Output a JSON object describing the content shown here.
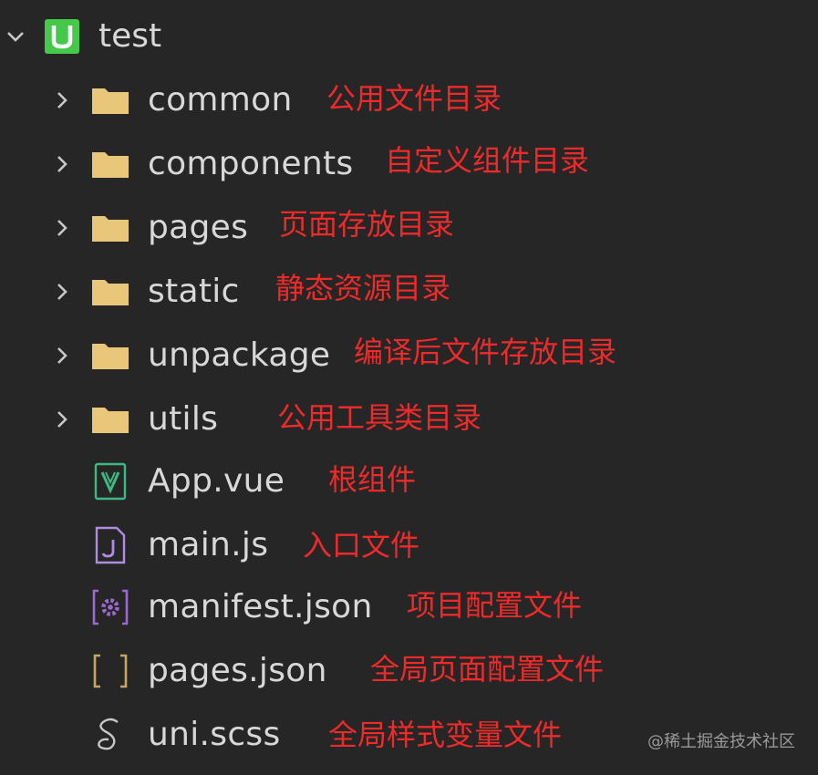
{
  "explorer": {
    "root": {
      "name": "test",
      "icon": "uniapp-project-icon",
      "expanded": true
    },
    "items": [
      {
        "name": "common",
        "type": "folder",
        "icon": "folder-icon",
        "note": "公用文件目录"
      },
      {
        "name": "components",
        "type": "folder",
        "icon": "folder-icon",
        "note": "自定义组件目录"
      },
      {
        "name": "pages",
        "type": "folder",
        "icon": "folder-icon",
        "note": "页面存放目录"
      },
      {
        "name": "static",
        "type": "folder",
        "icon": "folder-icon",
        "note": "静态资源目录"
      },
      {
        "name": "unpackage",
        "type": "folder",
        "icon": "folder-icon",
        "note": "编译后文件存放目录"
      },
      {
        "name": "utils",
        "type": "folder",
        "icon": "folder-icon",
        "note": "公用工具类目录"
      },
      {
        "name": "App.vue",
        "type": "file",
        "icon": "vue-file-icon",
        "note": "根组件"
      },
      {
        "name": "main.js",
        "type": "file",
        "icon": "js-file-icon",
        "note": "入口文件"
      },
      {
        "name": "manifest.json",
        "type": "file",
        "icon": "manifest-file-icon",
        "note": "项目配置文件"
      },
      {
        "name": "pages.json",
        "type": "file",
        "icon": "json-file-icon",
        "note": "全局页面配置文件"
      },
      {
        "name": "uni.scss",
        "type": "file",
        "icon": "scss-file-icon",
        "note": "全局样式变量文件"
      }
    ]
  },
  "watermark": "@稀土掘金技术社区",
  "colors": {
    "background": "#262626",
    "text": "#d8d8d8",
    "annotation": "#ee2a2a",
    "folder": "#e8c77a",
    "uniapp": "#46c84a",
    "vue": "#3fb984",
    "js": "#b08be0",
    "manifest": "#9a6ad0",
    "json": "#c9a660",
    "scss": "#c8c8c8"
  }
}
